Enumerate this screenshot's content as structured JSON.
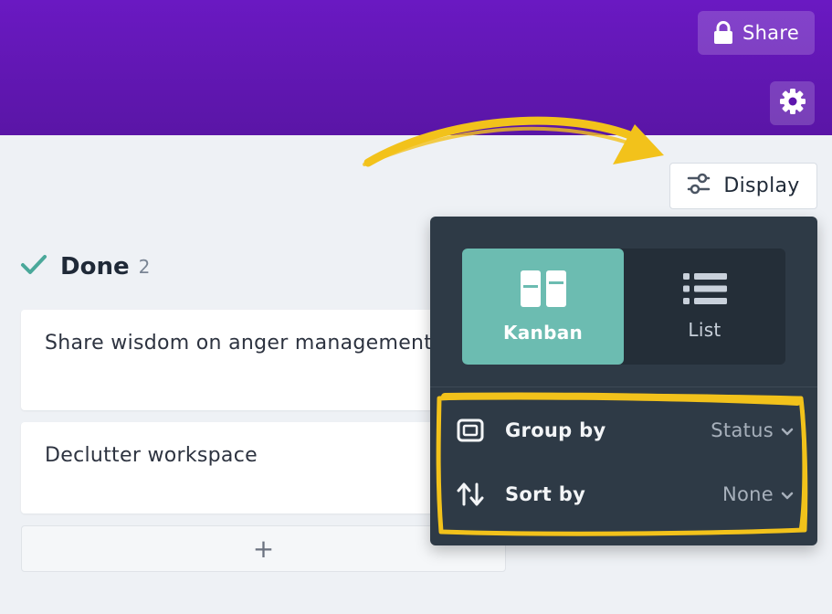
{
  "header": {
    "share_label": "Share",
    "accent_color": "#6a19c2"
  },
  "toolbar": {
    "display_label": "Display"
  },
  "group": {
    "title": "Done",
    "count": "2",
    "status_color": "#4aa89a"
  },
  "cards": [
    {
      "title": "Share wisdom on anger management"
    },
    {
      "title": "Declutter workspace"
    }
  ],
  "add_label": "+",
  "display_panel": {
    "views": [
      {
        "label": "Kanban",
        "icon": "kanban-icon",
        "active": true
      },
      {
        "label": "List",
        "icon": "list-icon",
        "active": false
      }
    ],
    "options": [
      {
        "label": "Group by",
        "value": "Status",
        "icon": "group-by-icon"
      },
      {
        "label": "Sort by",
        "value": "None",
        "icon": "sort-icon"
      }
    ],
    "active_color": "#6cbcb1"
  },
  "annotation": {
    "color": "#f2c21b"
  }
}
